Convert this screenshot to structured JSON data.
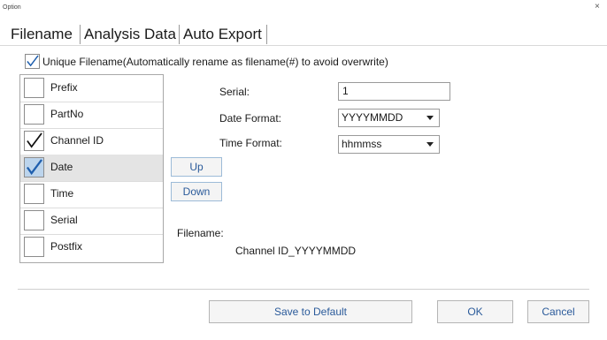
{
  "window": {
    "title": "Option",
    "close_glyph": "×"
  },
  "tabs": [
    {
      "label": "Filename"
    },
    {
      "label": "Analysis Data"
    },
    {
      "label": "Auto Export"
    }
  ],
  "unique_filename": {
    "label": "Unique Filename(Automatically rename as filename(#) to avoid overwrite)",
    "checked": true
  },
  "components": [
    {
      "label": "Prefix",
      "checked": false
    },
    {
      "label": "PartNo",
      "checked": false
    },
    {
      "label": "Channel ID",
      "checked": true
    },
    {
      "label": "Date",
      "checked": true,
      "selected": true
    },
    {
      "label": "Time",
      "checked": false
    },
    {
      "label": "Serial",
      "checked": false
    },
    {
      "label": "Postfix",
      "checked": false
    }
  ],
  "order_buttons": {
    "up": "Up",
    "down": "Down"
  },
  "form": {
    "serial_label": "Serial:",
    "serial_value": "1",
    "date_format_label": "Date Format:",
    "date_format_value": "YYYYMMDD",
    "time_format_label": "Time Format:",
    "time_format_value": "hhmmss"
  },
  "preview": {
    "label": "Filename:",
    "value": "Channel ID_YYYYMMDD"
  },
  "footer": {
    "save_default": "Save to Default",
    "ok": "OK",
    "cancel": "Cancel"
  },
  "colors": {
    "accent_text": "#2a5a9a",
    "check_mark": "#1f5fae",
    "checked_box_fill": "#bcd4ec"
  }
}
